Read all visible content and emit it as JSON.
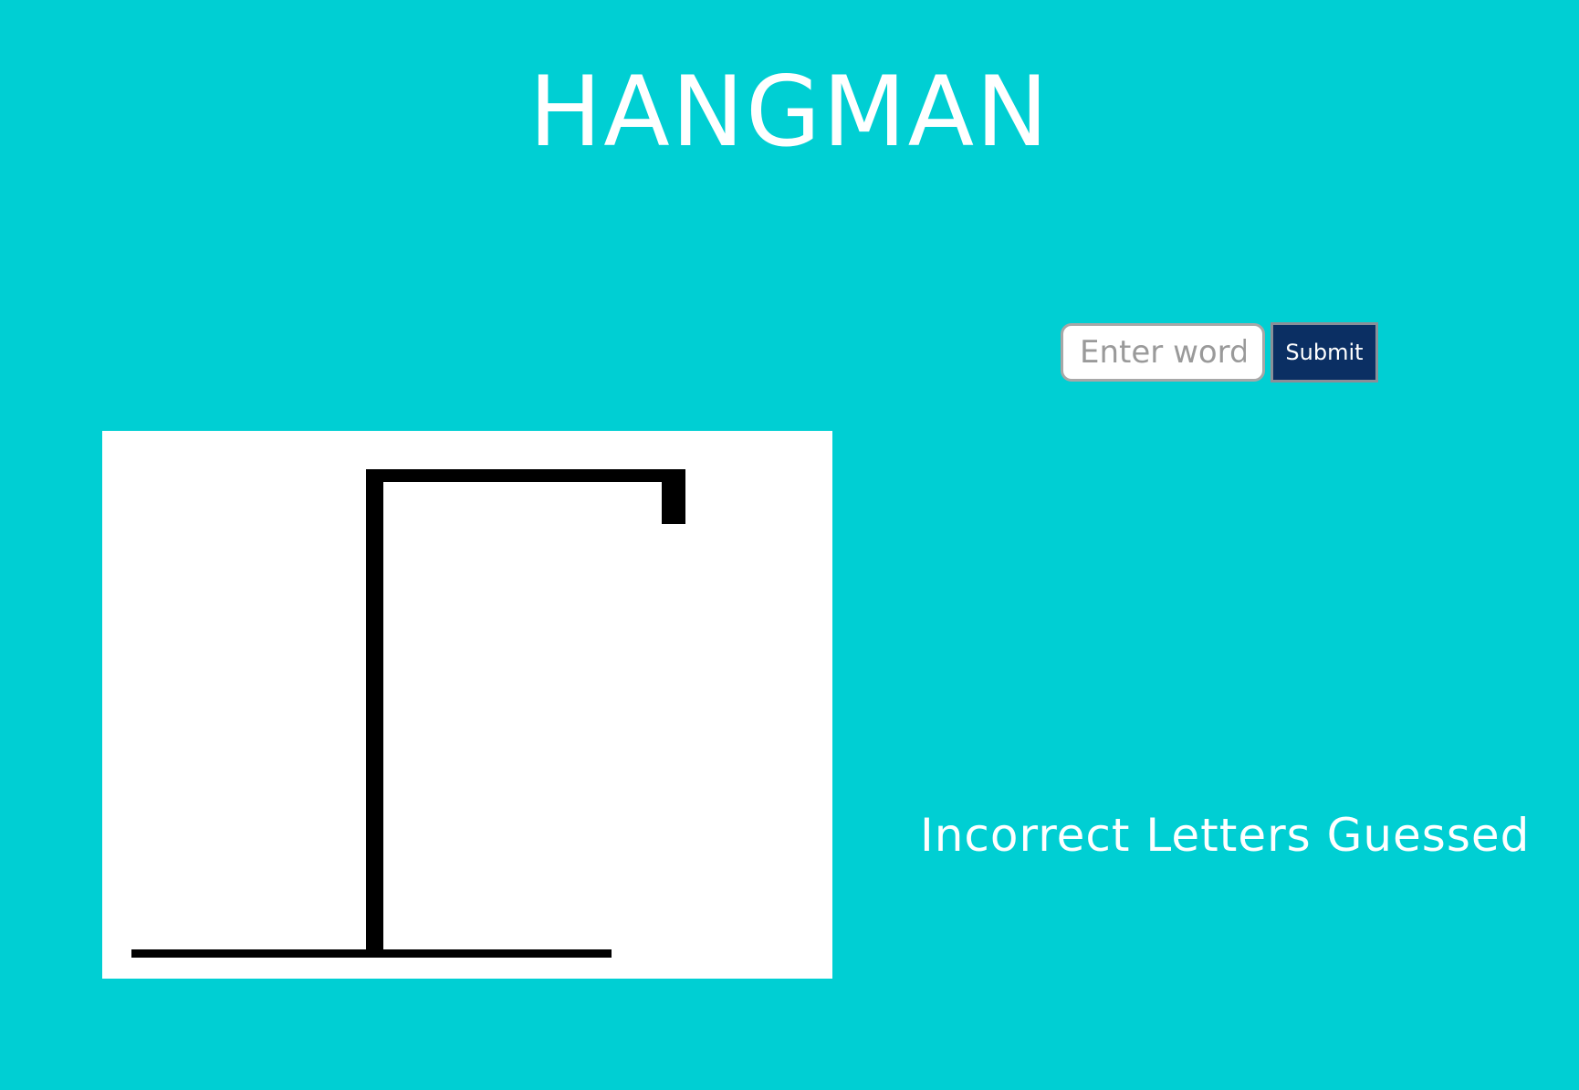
{
  "page": {
    "title": "HANGMAN",
    "background_color": "#00cfd3"
  },
  "guess_form": {
    "input_value": "",
    "input_placeholder": "Enter word",
    "submit_label": "Submit",
    "submit_color": "#0b2f63"
  },
  "gallows": {
    "wrong_guesses": 0,
    "parts_drawn": [
      "base",
      "pole",
      "beam",
      "rope"
    ]
  },
  "incorrect_letters": {
    "heading": "Incorrect Letters Guessed",
    "letters": []
  }
}
